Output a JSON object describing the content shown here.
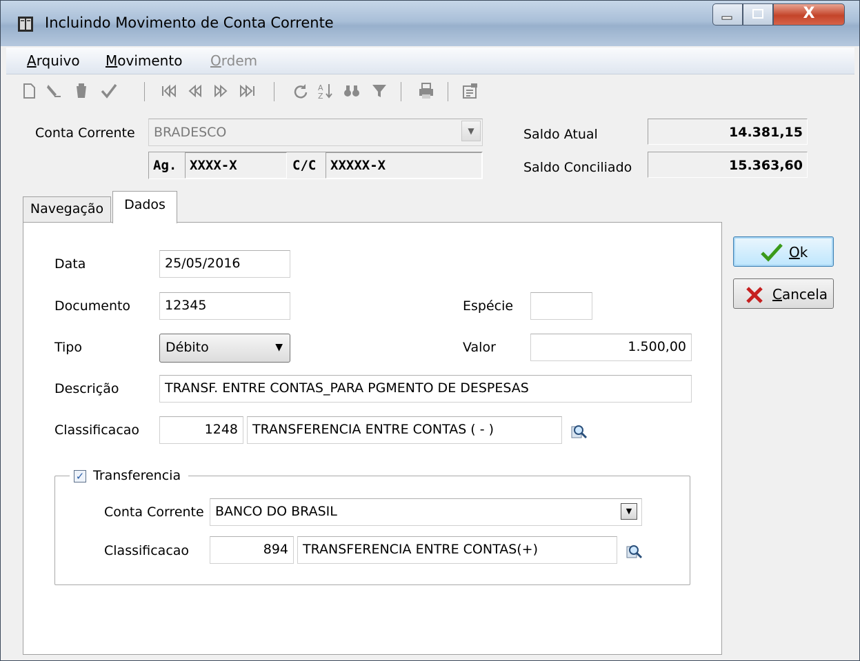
{
  "window": {
    "title": "Incluindo Movimento de Conta Corrente",
    "close_glyph": "X"
  },
  "menu": {
    "items": [
      {
        "label_first": "A",
        "label_rest": "rquivo"
      },
      {
        "label_first": "M",
        "label_rest": "ovimento"
      },
      {
        "label_first": "O",
        "label_rest": "rdem"
      }
    ]
  },
  "toolbar": {
    "icons": [
      "new-document-icon",
      "edit-pencil-icon",
      "delete-icon",
      "confirm-check-icon",
      "first-record-icon",
      "previous-record-icon",
      "next-record-icon",
      "last-record-icon",
      "refresh-icon",
      "sort-icon",
      "find-binoculars-icon",
      "filter-icon",
      "print-icon",
      "properties-icon"
    ]
  },
  "header": {
    "conta_corrente_label": "Conta Corrente",
    "conta_corrente_value": "BRADESCO",
    "ag_label": "Ag.",
    "ag_value": "XXXX-X",
    "cc_label": "C/C",
    "cc_value": "XXXXX-X",
    "saldo_atual_label": "Saldo Atual",
    "saldo_atual_value": "14.381,15",
    "saldo_conciliado_label": "Saldo Conciliado",
    "saldo_conciliado_value": "15.363,60"
  },
  "tabs": [
    {
      "label": "Navegação",
      "active": false
    },
    {
      "label": "Dados",
      "active": true
    }
  ],
  "form": {
    "data_label": "Data",
    "data_value": "25/05/2016",
    "documento_label": "Documento",
    "documento_value": "12345",
    "especie_label": "Espécie",
    "especie_value": "",
    "tipo_label": "Tipo",
    "tipo_value": "Débito",
    "valor_label": "Valor",
    "valor_value": "1.500,00",
    "descricao_label": "Descrição",
    "descricao_value": "TRANSF. ENTRE CONTAS_PARA PGMENTO DE DESPESAS",
    "classificacao_label": "Classificacao",
    "classificacao_code": "1248",
    "classificacao_desc": "TRANSFERENCIA ENTRE CONTAS ( - )"
  },
  "transferencia": {
    "label": "Transferencia",
    "checked": true,
    "check_glyph": "✓",
    "conta_corrente_label": "Conta Corrente",
    "conta_corrente_value": "BANCO DO BRASIL",
    "classificacao_label": "Classificacao",
    "classificacao_code": "894",
    "classificacao_desc": "TRANSFERENCIA ENTRE CONTAS(+)"
  },
  "actions": {
    "ok_first": "O",
    "ok_rest": "k",
    "cancela_first": "C",
    "cancela_rest": "ancela"
  },
  "colors": {
    "ok_check": "#3a9a1a",
    "cancel_x": "#c62020"
  }
}
